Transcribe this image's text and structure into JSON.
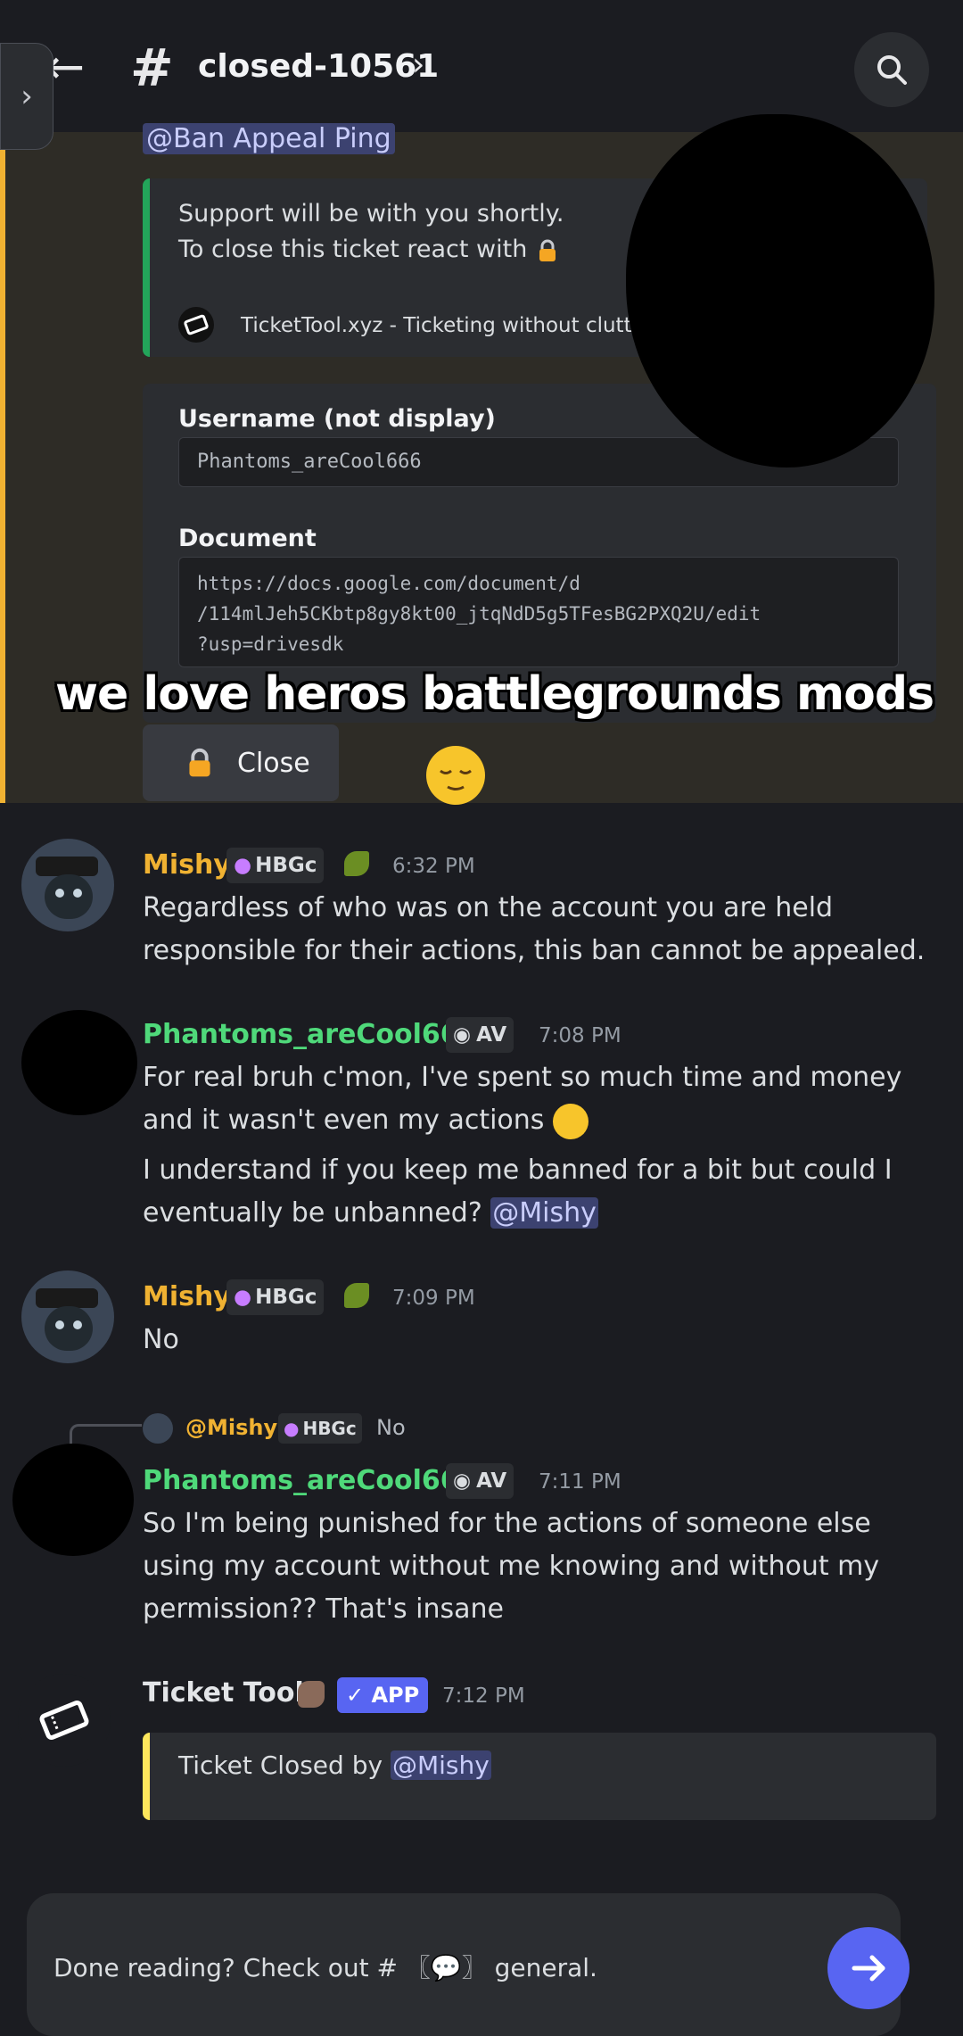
{
  "header": {
    "channel_name": "closed-10561",
    "hash_symbol": "#",
    "chevron": "›",
    "back_arrow": "←"
  },
  "embed_top": {
    "ping_label": "@Ban Appeal Ping",
    "line1": "Support will be with you shortly.",
    "line2": "To close this ticket react with",
    "footer": "TicketTool.xyz - Ticketing without clutte"
  },
  "form_embed": {
    "field1_label": "Username (not display)",
    "field1_value": "Phantoms_areCool666",
    "field2_label": "Document",
    "field2_line1": "https://docs.google.com/document/d",
    "field2_line2": "/114mlJeh5CKbtp8gy8kt00_jtqNdD5g5TFesBG2PXQ2U/edit",
    "field2_line3": "?usp=drivesdk"
  },
  "close_button_label": "Close",
  "overlay_caption": "we love heros battlegrounds mods",
  "messages": [
    {
      "author": "Mishy",
      "badge": "HBGc",
      "time": "6:32 PM",
      "text": "Regardless of who was on the account you are held responsible for their actions, this ban cannot be appealed."
    },
    {
      "author": "Phantoms_areCool666",
      "badge": "AV",
      "time": "7:08 PM",
      "text1": "For real bruh c'mon, I've spent so much time and money and it wasn't even my actions",
      "text2": "I understand if you keep me banned for a bit but could I eventually be unbanned?",
      "mention": "@Mishy"
    },
    {
      "author": "Mishy",
      "badge": "HBGc",
      "time": "7:09 PM",
      "text": "No"
    },
    {
      "reply_to": "@Mishy",
      "reply_badge": "HBGc",
      "reply_text": "No",
      "author": "Phantoms_areCool666",
      "badge": "AV",
      "time": "7:11 PM",
      "text": "So I'm being punished for the actions of someone else using my account without me knowing and without my permission?? That's insane"
    },
    {
      "author": "Ticket Tool",
      "badge": "✓ APP",
      "time": "7:12 PM",
      "embed_text": "Ticket Closed by",
      "mention": "@Mishy"
    }
  ],
  "bottom_bar": {
    "text": "Done reading? Check out # 〖💬〗 general."
  },
  "colors": {
    "background": "#1b1c21",
    "highlight_border": "#f0b232",
    "mishy_name": "#f0b232",
    "phantoms_name": "#4fd97a",
    "accent": "#5865f2",
    "embed_green": "#23a55a",
    "embed_yellow": "#fee75c"
  }
}
